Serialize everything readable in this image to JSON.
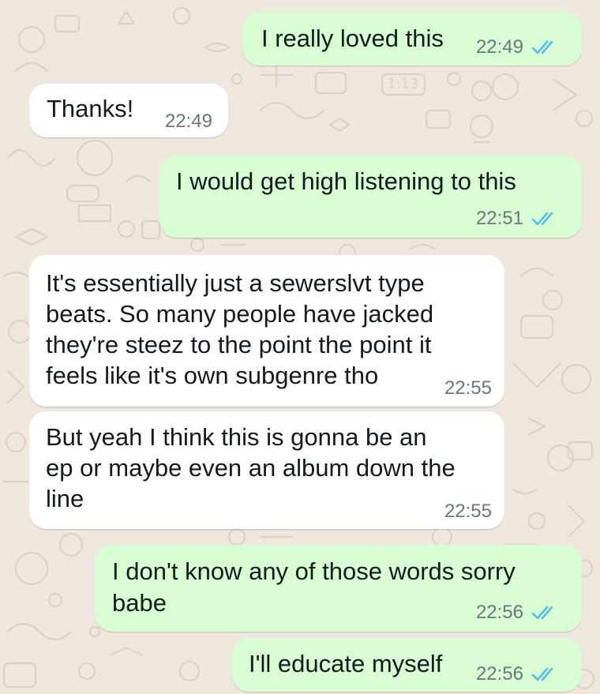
{
  "theme": {
    "outgoing_bubble": "#d9fdd3",
    "incoming_bubble": "#ffffff",
    "wallpaper": "#efe7de",
    "read_tick": "#53bdeb",
    "meta_text": "#667781"
  },
  "messages": [
    {
      "direction": "outgoing",
      "lines": [
        "I really loved this"
      ],
      "time": "22:49",
      "status_icon": "double-check-read-icon"
    },
    {
      "direction": "incoming",
      "lines": [
        "Thanks!"
      ],
      "time": "22:49"
    },
    {
      "direction": "outgoing",
      "lines": [
        "I would get high listening to this"
      ],
      "time": "22:51",
      "status_icon": "double-check-read-icon"
    },
    {
      "direction": "incoming",
      "lines": [
        "It's essentially just a sewerslvt type",
        "beats. So many people have jacked",
        "they're steez to the point the point it",
        "feels like it's own subgenre tho"
      ],
      "time": "22:55"
    },
    {
      "direction": "incoming",
      "lines": [
        "But yeah I think this is gonna be an",
        "ep or maybe even an album down the",
        "line"
      ],
      "time": "22:55"
    },
    {
      "direction": "outgoing",
      "lines": [
        "I don't know any of those words sorry",
        "babe"
      ],
      "time": "22:56",
      "status_icon": "double-check-read-icon"
    },
    {
      "direction": "outgoing",
      "lines": [
        "I'll educate myself"
      ],
      "time": "22:56",
      "status_icon": "double-check-read-icon"
    }
  ]
}
